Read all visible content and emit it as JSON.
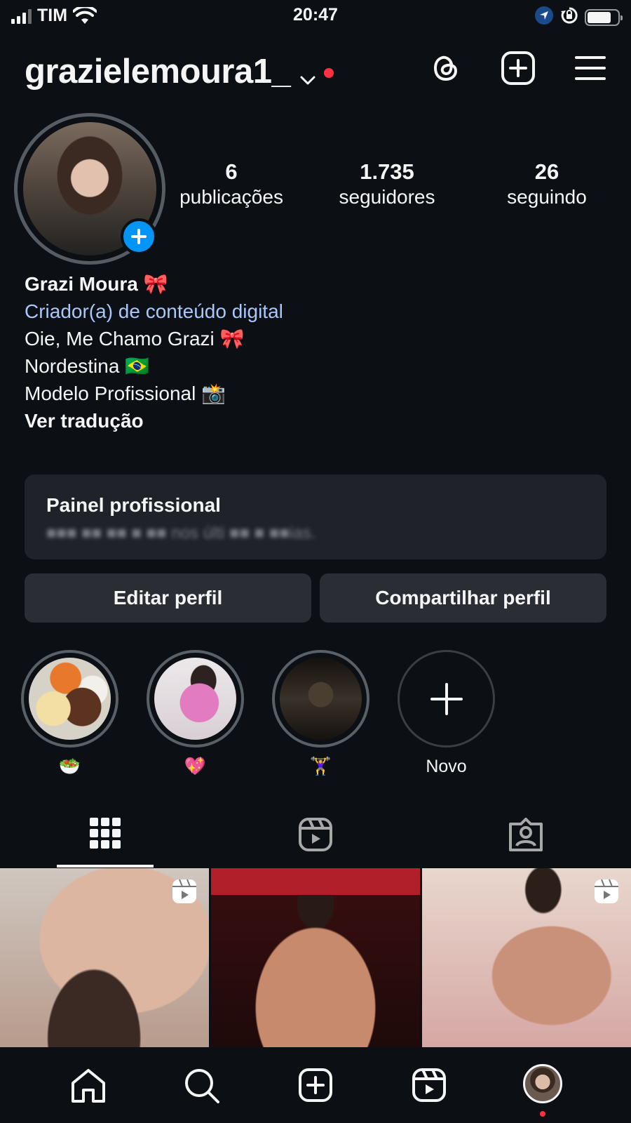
{
  "status_bar": {
    "carrier": "TIM",
    "time": "20:47"
  },
  "header": {
    "username": "grazielemoura1_"
  },
  "stats": [
    {
      "value": "6",
      "label": "publicações"
    },
    {
      "value": "1.735",
      "label": "seguidores"
    },
    {
      "value": "26",
      "label": "seguindo"
    }
  ],
  "bio": {
    "name": "Grazi Moura 🎀",
    "category": "Criador(a) de conteúdo digital",
    "lines": [
      "Oie, Me Chamo Grazi 🎀",
      "Nordestina 🇧🇷",
      "Modelo Profissional 📸"
    ],
    "translate": "Ver tradução"
  },
  "dashboard": {
    "title": "Painel profissional",
    "subtitle": "■■■  ■■ ■■ ■ ■■ nos últi ■■ ■ ■■ias."
  },
  "buttons": {
    "edit": "Editar perfil",
    "share": "Compartilhar perfil"
  },
  "highlights": [
    {
      "label": "🥗"
    },
    {
      "label": "💖"
    },
    {
      "label": "🏋️‍♀️"
    },
    {
      "label": "Novo"
    }
  ],
  "colors": {
    "background": "#0c1014",
    "accent": "#0095f6",
    "category": "#a8c7fa",
    "notification": "#ff3040"
  }
}
